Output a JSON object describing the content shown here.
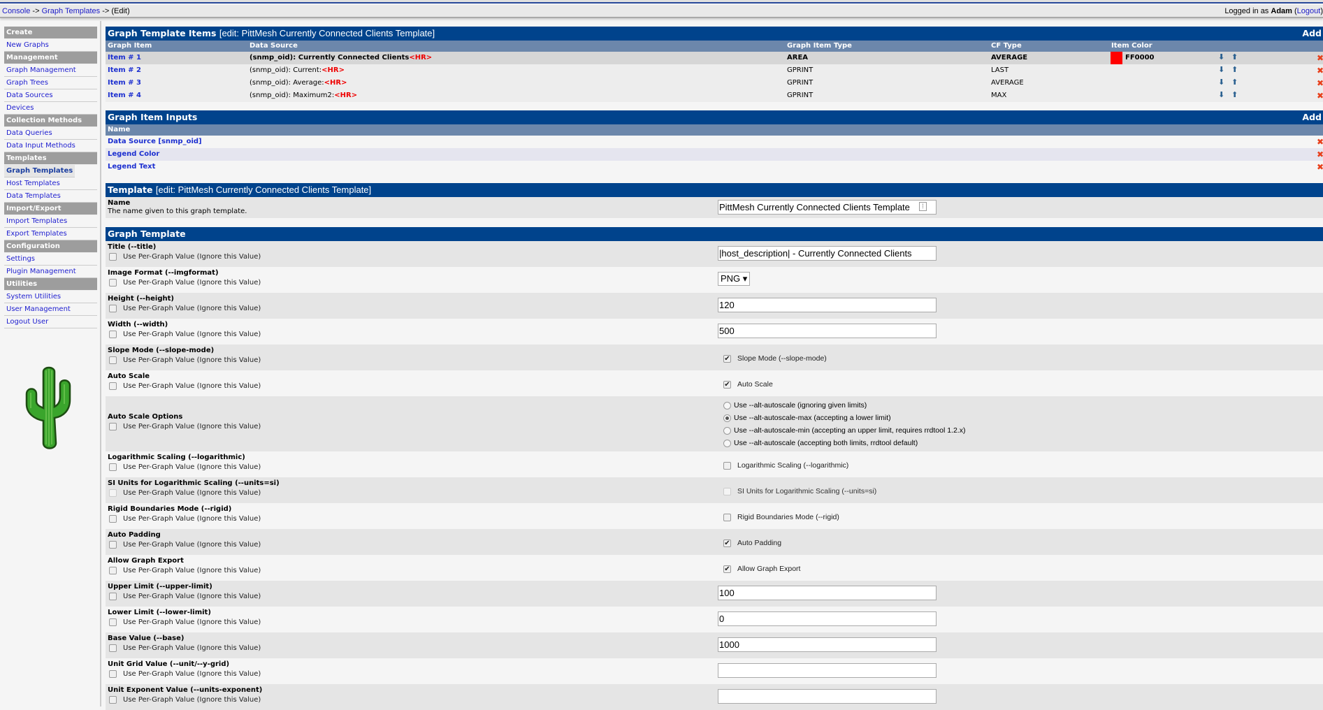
{
  "breadcrumb": {
    "console": "Console",
    "sep": "->",
    "graph_templates": "Graph Templates",
    "current": "(Edit)"
  },
  "login": {
    "prefix": "Logged in as",
    "user": "Adam",
    "logout": "Logout"
  },
  "sidebar": [
    {
      "type": "header",
      "label": "Create"
    },
    {
      "type": "item",
      "label": "New Graphs"
    },
    {
      "type": "header",
      "label": "Management"
    },
    {
      "type": "item",
      "label": "Graph Management"
    },
    {
      "type": "item",
      "label": "Graph Trees"
    },
    {
      "type": "item",
      "label": "Data Sources"
    },
    {
      "type": "item",
      "label": "Devices"
    },
    {
      "type": "header",
      "label": "Collection Methods"
    },
    {
      "type": "item",
      "label": "Data Queries"
    },
    {
      "type": "item",
      "label": "Data Input Methods"
    },
    {
      "type": "header",
      "label": "Templates"
    },
    {
      "type": "item",
      "label": "Graph Templates",
      "selected": true
    },
    {
      "type": "item",
      "label": "Host Templates"
    },
    {
      "type": "item",
      "label": "Data Templates"
    },
    {
      "type": "header",
      "label": "Import/Export"
    },
    {
      "type": "item",
      "label": "Import Templates"
    },
    {
      "type": "item",
      "label": "Export Templates"
    },
    {
      "type": "header",
      "label": "Configuration"
    },
    {
      "type": "item",
      "label": "Settings"
    },
    {
      "type": "item",
      "label": "Plugin Management"
    },
    {
      "type": "header",
      "label": "Utilities"
    },
    {
      "type": "item",
      "label": "System Utilities"
    },
    {
      "type": "item",
      "label": "User Management"
    },
    {
      "type": "item",
      "label": "Logout User"
    }
  ],
  "items_section": {
    "title": "Graph Template Items",
    "subtitle": "[edit: PittMesh Currently Connected Clients Template]",
    "add": "Add",
    "columns": [
      "Graph Item",
      "Data Source",
      "Graph Item Type",
      "CF Type",
      "Item Color"
    ],
    "rows": [
      {
        "item": "Item # 1",
        "source": "(snmp_oid): Currently Connected Clients",
        "hr": "<HR>",
        "type": "AREA",
        "cf": "AVERAGE",
        "color": "FF0000",
        "color_hex": "#FF0000"
      },
      {
        "item": "Item # 2",
        "source": "(snmp_oid): Current:",
        "hr": "<HR>",
        "type": "GPRINT",
        "cf": "LAST",
        "color": ""
      },
      {
        "item": "Item # 3",
        "source": "(snmp_oid): Average:",
        "hr": "<HR>",
        "type": "GPRINT",
        "cf": "AVERAGE",
        "color": ""
      },
      {
        "item": "Item # 4",
        "source": "(snmp_oid): Maximum2:",
        "hr": "<HR>",
        "type": "GPRINT",
        "cf": "MAX",
        "color": ""
      }
    ]
  },
  "inputs_section": {
    "title": "Graph Item Inputs",
    "add": "Add",
    "column": "Name",
    "rows": [
      "Data Source [snmp_oid]",
      "Legend Color",
      "Legend Text"
    ]
  },
  "template_section": {
    "title": "Template",
    "subtitle": "[edit: PittMesh Currently Connected Clients Template]",
    "name_label": "Name",
    "name_desc": "The name given to this graph template.",
    "name_value": "PittMesh Currently Connected Clients Template"
  },
  "graph_template": {
    "title": "Graph Template",
    "per_graph_label": "Use Per-Graph Value (Ignore this Value)",
    "rows": [
      {
        "label": "Title (--title)",
        "kind": "text",
        "value": "|host_description| - Currently Connected Clients"
      },
      {
        "label": "Image Format (--imgformat)",
        "kind": "select",
        "value": "PNG"
      },
      {
        "label": "Height (--height)",
        "kind": "text",
        "value": "120"
      },
      {
        "label": "Width (--width)",
        "kind": "text",
        "value": "500"
      },
      {
        "label": "Slope Mode (--slope-mode)",
        "kind": "checkbox",
        "checked": true,
        "text": "Slope Mode (--slope-mode)"
      },
      {
        "label": "Auto Scale",
        "kind": "checkbox",
        "checked": true,
        "text": "Auto Scale"
      },
      {
        "label": "Auto Scale Options",
        "kind": "radio",
        "options": [
          {
            "text": "Use --alt-autoscale (ignoring given limits)",
            "checked": false
          },
          {
            "text": "Use --alt-autoscale-max (accepting a lower limit)",
            "checked": true
          },
          {
            "text": "Use --alt-autoscale-min (accepting an upper limit, requires rrdtool 1.2.x)",
            "checked": false
          },
          {
            "text": "Use --alt-autoscale (accepting both limits, rrdtool default)",
            "checked": false
          }
        ]
      },
      {
        "label": "Logarithmic Scaling (--logarithmic)",
        "kind": "checkbox",
        "checked": false,
        "text": "Logarithmic Scaling (--logarithmic)"
      },
      {
        "label": "SI Units for Logarithmic Scaling (--units=si)",
        "kind": "checkbox",
        "checked": false,
        "disabled": true,
        "text": "SI Units for Logarithmic Scaling (--units=si)"
      },
      {
        "label": "Rigid Boundaries Mode (--rigid)",
        "kind": "checkbox",
        "checked": false,
        "text": "Rigid Boundaries Mode (--rigid)"
      },
      {
        "label": "Auto Padding",
        "kind": "checkbox",
        "checked": true,
        "text": "Auto Padding"
      },
      {
        "label": "Allow Graph Export",
        "kind": "checkbox",
        "checked": true,
        "text": "Allow Graph Export"
      },
      {
        "label": "Upper Limit (--upper-limit)",
        "kind": "text",
        "value": "100"
      },
      {
        "label": "Lower Limit (--lower-limit)",
        "kind": "text",
        "value": "0"
      },
      {
        "label": "Base Value (--base)",
        "kind": "text",
        "value": "1000"
      },
      {
        "label": "Unit Grid Value (--unit/--y-grid)",
        "kind": "text",
        "value": ""
      },
      {
        "label": "Unit Exponent Value (--units-exponent)",
        "kind": "text",
        "value": ""
      }
    ]
  },
  "icons": {
    "move_down": "arrow-down-icon",
    "move_up": "arrow-up-icon",
    "delete": "delete-x-icon",
    "logo": "cactus-logo"
  },
  "colors": {
    "header": "#00438C",
    "column_header": "#6C87AB",
    "sidebar_header": "#9D9D9D",
    "link": "#1C2FD0",
    "hr_tag": "#EE0000"
  }
}
